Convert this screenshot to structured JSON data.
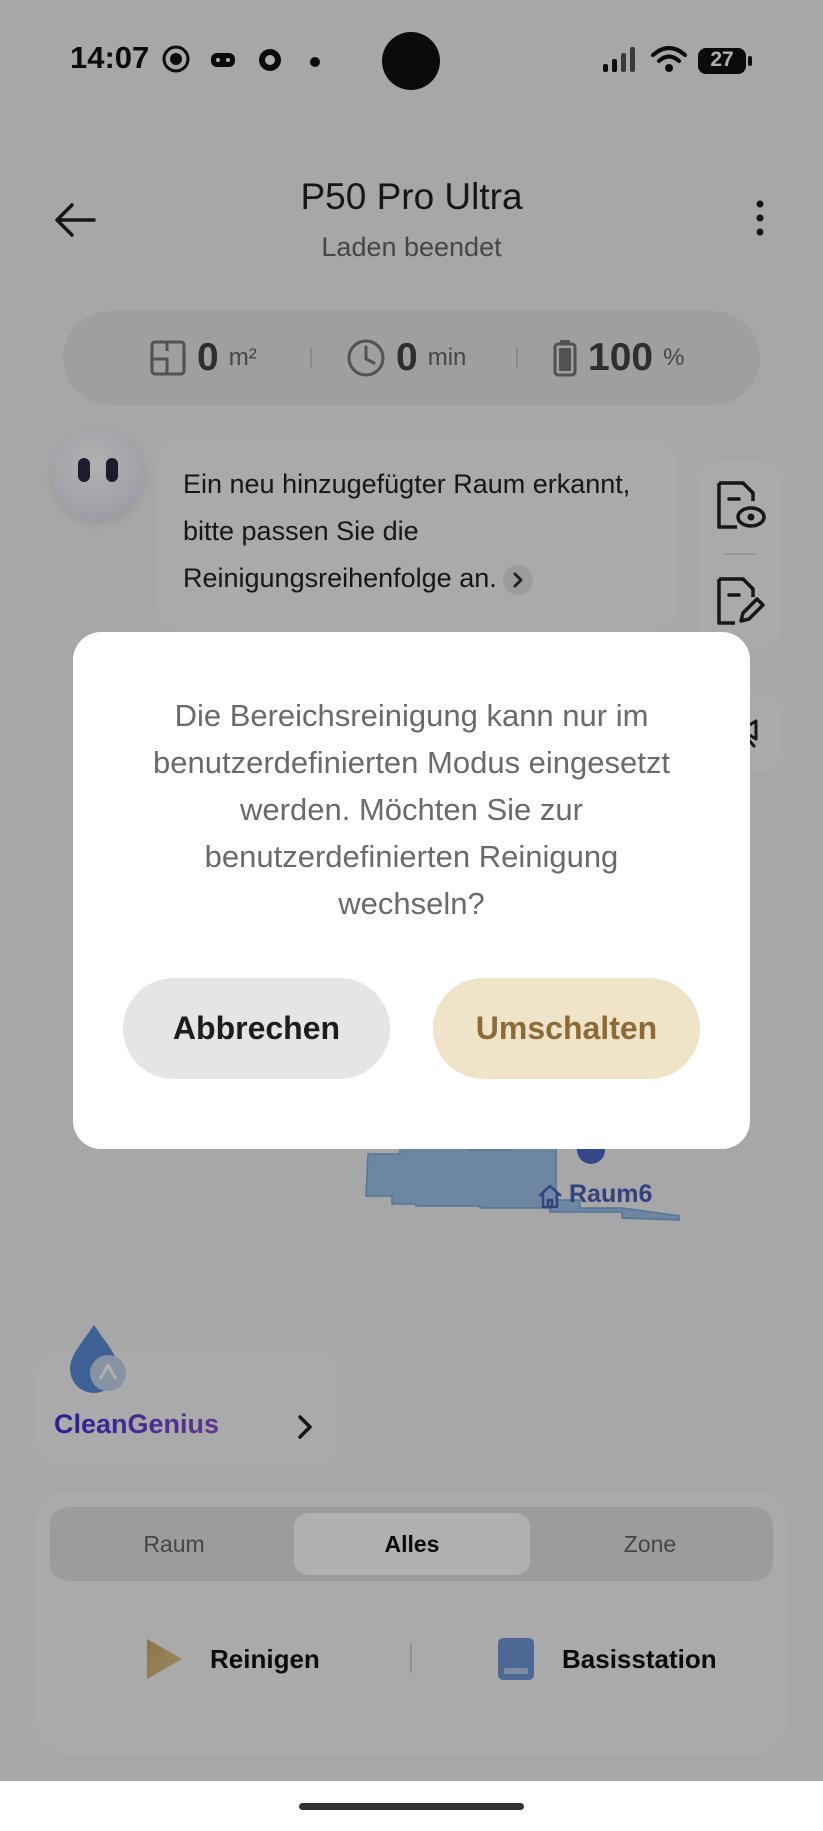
{
  "status_bar": {
    "time": "14:07",
    "battery": "27"
  },
  "header": {
    "title": "P50 Pro Ultra",
    "subtitle": "Laden beendet"
  },
  "stats": {
    "area_value": "0",
    "area_unit": "m²",
    "time_value": "0",
    "time_unit": "min",
    "battery_value": "100",
    "battery_unit": "%"
  },
  "message": {
    "text": "Ein neu hinzugefügter Raum erkannt, bitte passen Sie die Reinigungsreihenfolge an."
  },
  "map": {
    "room_label": "Raum6"
  },
  "clean_genius": {
    "label": "CleanGenius"
  },
  "modes": {
    "tabs": [
      "Raum",
      "Alles",
      "Zone"
    ],
    "active": "Alles"
  },
  "actions": {
    "clean_label": "Reinigen",
    "base_label": "Basisstation"
  },
  "dialog": {
    "message": "Die Bereichsreinigung kann nur im benutzerdefinierten Modus eingesetzt werden. Möchten Sie zur benutzerdefinierten Reinigung wechseln?",
    "cancel_label": "Abbrechen",
    "confirm_label": "Umschalten"
  },
  "colors": {
    "accent_gold": "#8c6a3a",
    "accent_gold_bg": "#efe3c8",
    "map_blue": "#9ec4ec",
    "brand_purple": "#5b3fd4"
  }
}
